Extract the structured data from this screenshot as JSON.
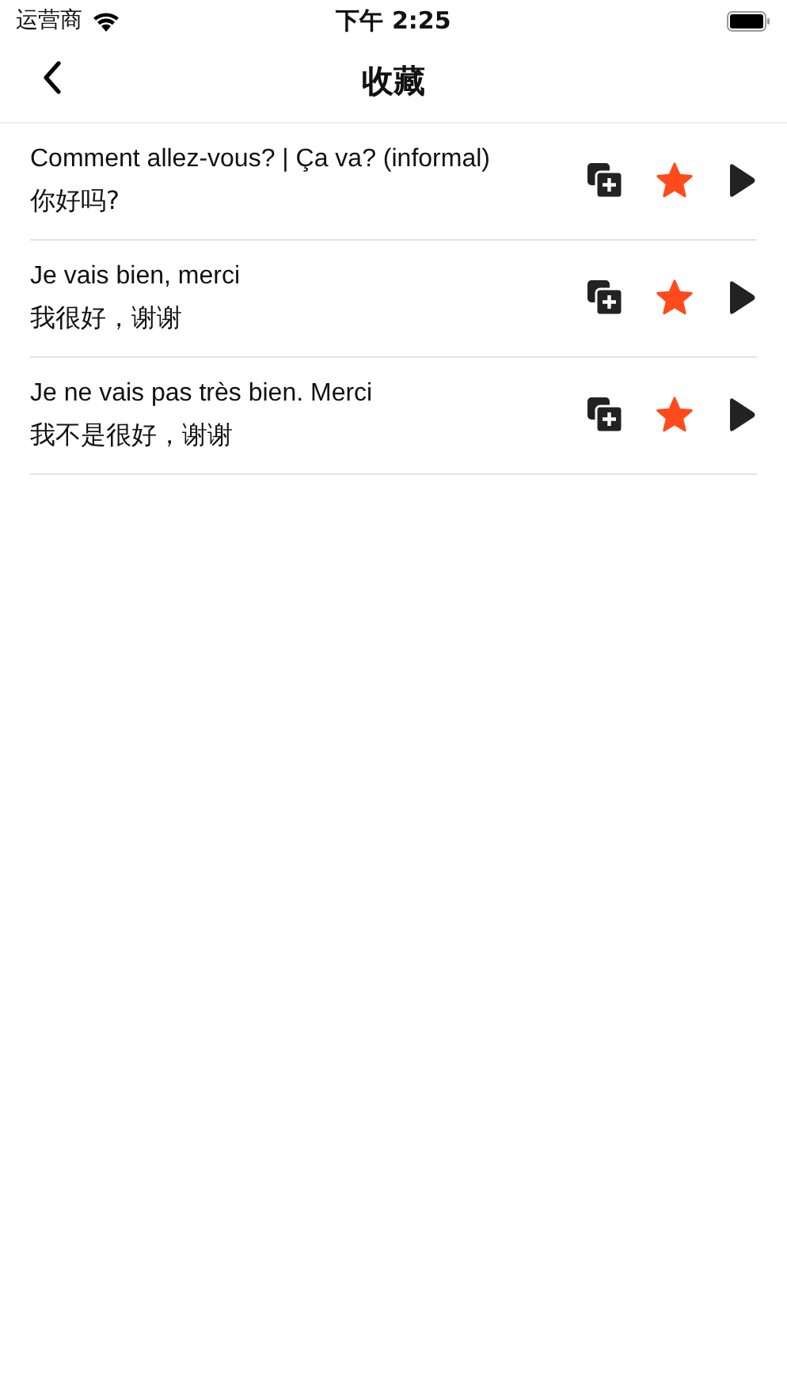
{
  "status_bar": {
    "carrier": "运营商",
    "time": "下午 2:25"
  },
  "nav": {
    "title": "收藏"
  },
  "items": [
    {
      "phrase": "Comment allez-vous? | Ça va? (informal)",
      "translation": "你好吗?",
      "favorite": true
    },
    {
      "phrase": "Je vais bien, merci",
      "translation": "我很好，谢谢",
      "favorite": true
    },
    {
      "phrase": "Je ne vais pas très bien. Merci",
      "translation": "我不是很好，谢谢",
      "favorite": true
    }
  ]
}
